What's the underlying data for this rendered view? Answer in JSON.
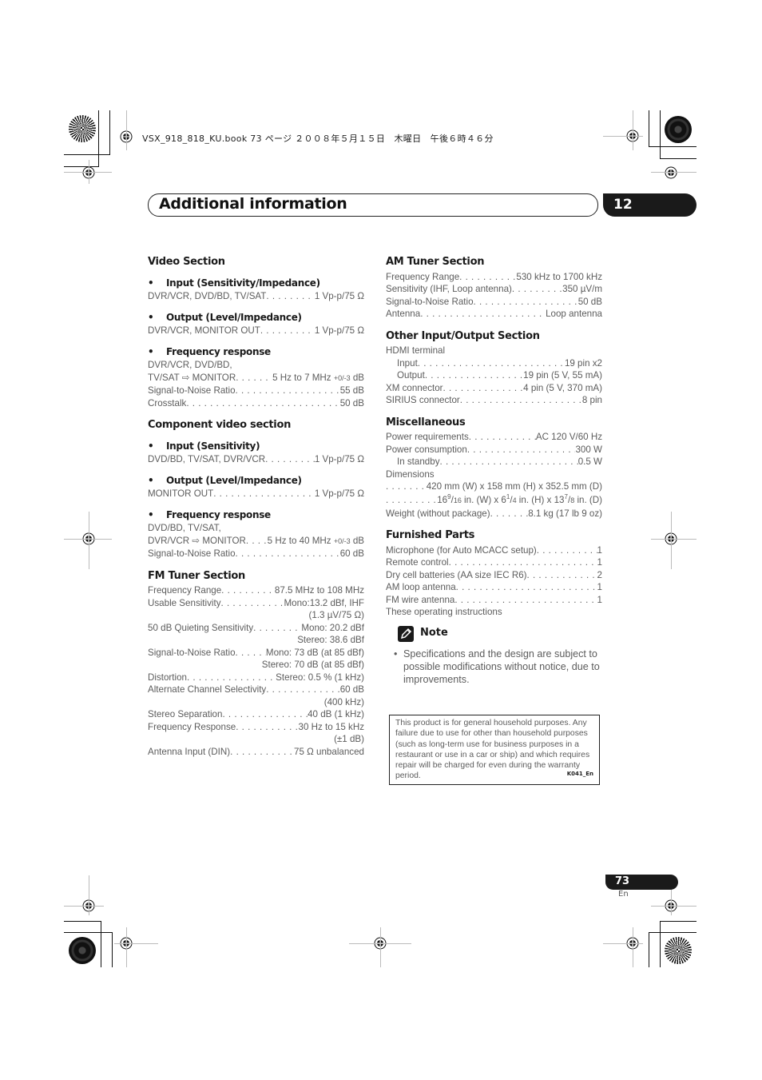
{
  "print_header": "VSX_918_818_KU.book  73 ページ  ２００８年５月１５日　木曜日　午後６時４６分",
  "chapter": {
    "title": "Additional information",
    "number": "12"
  },
  "left_column": {
    "video_section": {
      "heading": "Video Section",
      "input": {
        "label": "Input (Sensitivity/Impedance)",
        "rows": [
          {
            "k": "DVR/VCR, DVD/BD, TV/SAT",
            "v": "1 Vp-p/75 Ω"
          }
        ]
      },
      "output": {
        "label": "Output (Level/Impedance)",
        "rows": [
          {
            "k": "DVR/VCR, MONITOR OUT",
            "v": "1 Vp-p/75 Ω"
          }
        ]
      },
      "freq": {
        "label": "Frequency response",
        "line1": "DVR/VCR, DVD/BD,",
        "rows": [
          {
            "k": "TV/SAT ⇨ MONITOR",
            "v": "5 Hz to 7 MHz",
            "tol": "+0/-3",
            "unit": "dB"
          },
          {
            "k": "Signal-to-Noise Ratio",
            "v": "55 dB"
          },
          {
            "k": "Crosstalk",
            "v": "50 dB"
          }
        ]
      }
    },
    "component_video": {
      "heading": "Component video section",
      "input": {
        "label": "Input (Sensitivity)",
        "rows": [
          {
            "k": "DVD/BD, TV/SAT, DVR/VCR",
            "v": "1 Vp-p/75 Ω"
          }
        ]
      },
      "output": {
        "label": "Output (Level/Impedance)",
        "rows": [
          {
            "k": "MONITOR OUT",
            "v": "1 Vp-p/75 Ω"
          }
        ]
      },
      "freq": {
        "label": "Frequency response",
        "line1": "DVD/BD, TV/SAT,",
        "rows": [
          {
            "k": "DVR/VCR ⇨ MONITOR",
            "v": "5 Hz to 40 MHz",
            "tol": "+0/-3",
            "unit": "dB"
          },
          {
            "k": "Signal-to-Noise Ratio",
            "v": "60 dB"
          }
        ]
      }
    },
    "fm_tuner": {
      "heading": "FM Tuner Section",
      "rows": [
        {
          "k": "Frequency Range",
          "v": "87.5 MHz to 108 MHz"
        },
        {
          "k": "Usable Sensitivity",
          "v": "Mono:13.2 dBf, IHF",
          "cont": "(1.3 µV/75 Ω)"
        },
        {
          "k": "50 dB Quieting Sensitivity",
          "v": "Mono: 20.2 dBf",
          "cont": "Stereo: 38.6 dBf"
        },
        {
          "k": "Signal-to-Noise Ratio",
          "v": "Mono: 73 dB (at 85 dBf)",
          "cont": "Stereo: 70 dB (at 85 dBf)"
        },
        {
          "k": "Distortion",
          "v": "Stereo: 0.5 % (1 kHz)"
        },
        {
          "k": "Alternate Channel Selectivity",
          "v": "60 dB",
          "cont": "(400 kHz)"
        },
        {
          "k": "Stereo Separation",
          "v": "40 dB (1 kHz)"
        },
        {
          "k": "Frequency Response",
          "v": "30 Hz to 15 kHz",
          "cont": "(±1 dB)"
        },
        {
          "k": "Antenna Input (DIN)",
          "v": "75 Ω unbalanced"
        }
      ]
    }
  },
  "right_column": {
    "am_tuner": {
      "heading": "AM Tuner Section",
      "rows": [
        {
          "k": "Frequency Range",
          "v": "530 kHz to 1700 kHz"
        },
        {
          "k": "Sensitivity (IHF, Loop antenna)",
          "v": "350 µV/m"
        },
        {
          "k": "Signal-to-Noise Ratio",
          "v": "50 dB"
        },
        {
          "k": "Antenna",
          "v": "Loop antenna"
        }
      ]
    },
    "other_io": {
      "heading": "Other Input/Output Section",
      "hdmi_label": "HDMI terminal",
      "rows": [
        {
          "k": "Input",
          "v": "19 pin x2",
          "indent": true
        },
        {
          "k": "Output",
          "v": "19 pin (5 V, 55 mA)",
          "indent": true
        },
        {
          "k": "XM connector",
          "v": "4 pin (5 V, 370 mA)"
        },
        {
          "k": "SIRIUS connector",
          "v": "8 pin"
        }
      ]
    },
    "misc": {
      "heading": "Miscellaneous",
      "rows": [
        {
          "k": "Power requirements",
          "v": "AC 120 V/60 Hz"
        },
        {
          "k": "Power consumption",
          "v": "300 W"
        },
        {
          "k": "In standby",
          "v": "0.5 W",
          "indent": true
        }
      ],
      "dimensions_label": "Dimensions",
      "dim_mm": "420 mm (W) x 158 mm (H) x 352.5 mm (D)",
      "dim_in": {
        "w_whole": "16",
        "w_num": "9",
        "w_den": "16",
        "h_whole": "6",
        "h_num": "1",
        "h_den": "4",
        "d_whole": "13",
        "d_num": "7",
        "d_den": "8"
      },
      "dim_in_text": {
        "in_w": " in. (W) x ",
        "in_h": " in. (H) x ",
        "in_d": " in. (D)"
      },
      "weight": {
        "k": "Weight (without package)",
        "v": "8.1 kg (17 lb 9 oz)"
      }
    },
    "furnished": {
      "heading": "Furnished Parts",
      "rows": [
        {
          "k": "Microphone (for Auto MCACC setup)",
          "v": "1"
        },
        {
          "k": "Remote control",
          "v": "1"
        },
        {
          "k": "Dry cell batteries (AA size IEC R6)",
          "v": "2"
        },
        {
          "k": "AM loop antenna",
          "v": "1"
        },
        {
          "k": "FM wire antenna",
          "v": "1"
        }
      ],
      "last": "These operating instructions"
    },
    "note": {
      "heading": "Note",
      "icon": "pencil-icon",
      "bullet": "•",
      "text": "Specifications and the design are subject to possible modifications without notice, due to improvements."
    },
    "warranty": {
      "text": "This product is for general household purposes. Any failure due to use for other than household purposes (such as long-term use for business purposes in a restaurant or use in a car or ship) and which requires repair will be charged for even during the warranty period.",
      "code": "K041_En"
    }
  },
  "footer": {
    "page": "73",
    "lang": "En"
  }
}
